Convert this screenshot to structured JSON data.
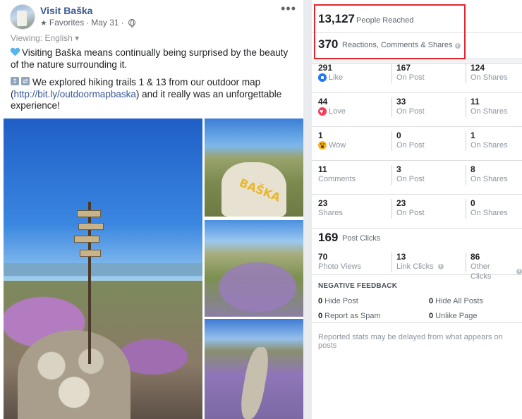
{
  "post": {
    "page_name": "Visit Baška",
    "meta_audience": "Favorites",
    "meta_date": "May 31",
    "viewing": "Viewing: English ▾",
    "more": "•••",
    "paragraph1": "Visiting Baška means continually being surprised by the beauty of the nature surrounding it.",
    "paragraph2_prefix": "We explored hiking trails 1 & 13 from our outdoor map (",
    "paragraph2_link": "http://bit.ly/outdoormapbaska",
    "paragraph2_suffix": ") and it really was an unforgettable experience!",
    "photo_text": "BAŠKA"
  },
  "insights": {
    "reach": {
      "value": "13,127",
      "label": "People Reached"
    },
    "engagement": {
      "value": "370",
      "label": "Reactions, Comments & Shares"
    },
    "rows": [
      {
        "total": "291",
        "label": "Like",
        "icon": "like-icon",
        "on_post": "167",
        "on_post_label": "On Post",
        "on_shares": "124",
        "on_shares_label": "On Shares"
      },
      {
        "total": "44",
        "label": "Love",
        "icon": "love-icon",
        "on_post": "33",
        "on_post_label": "On Post",
        "on_shares": "11",
        "on_shares_label": "On Shares"
      },
      {
        "total": "1",
        "label": "Wow",
        "icon": "wow-icon",
        "on_post": "0",
        "on_post_label": "On Post",
        "on_shares": "1",
        "on_shares_label": "On Shares"
      },
      {
        "total": "11",
        "label": "Comments",
        "icon": "",
        "on_post": "3",
        "on_post_label": "On Post",
        "on_shares": "8",
        "on_shares_label": "On Shares"
      },
      {
        "total": "23",
        "label": "Shares",
        "icon": "",
        "on_post": "23",
        "on_post_label": "On Post",
        "on_shares": "0",
        "on_shares_label": "On Shares"
      }
    ],
    "post_clicks": {
      "value": "169",
      "label": "Post Clicks",
      "photo_views": "70",
      "photo_views_label": "Photo Views",
      "link_clicks": "13",
      "link_clicks_label": "Link Clicks",
      "other_clicks": "86",
      "other_clicks_label": "Other Clicks"
    },
    "negative": {
      "title": "NEGATIVE FEEDBACK",
      "hide_post": "0",
      "hide_post_label": "Hide Post",
      "hide_all": "0",
      "hide_all_label": "Hide All Posts",
      "report_spam": "0",
      "report_spam_label": "Report as Spam",
      "unlike_page": "0",
      "unlike_page_label": "Unlike Page"
    },
    "footnote": "Reported stats may be delayed from what appears on posts"
  },
  "colors": {
    "link": "#385898",
    "highlight": "#e0262b",
    "like": "#2078f4",
    "love": "#f33e58",
    "wow": "#f7b125"
  }
}
